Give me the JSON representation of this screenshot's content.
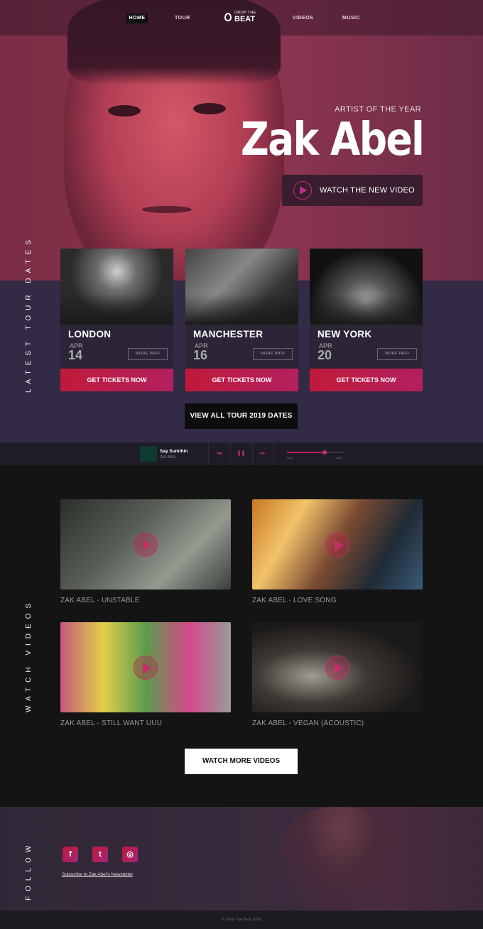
{
  "nav": {
    "home": "HOME",
    "tour": "TOUR",
    "logo_small": "DROP THE",
    "logo_big": "BEAT",
    "videos": "VIDEOS",
    "music": "MUSIC"
  },
  "hero": {
    "subtitle": "ARTIST OF THE YEAR",
    "artist_name": "Zak Abel",
    "watch_button": "WATCH THE NEW VIDEO"
  },
  "tour": {
    "section_label": "LATEST TOUR DATES",
    "cards": [
      {
        "city": "LONDON",
        "month": "APR",
        "day": "14",
        "more_info": "MORE INFO",
        "tickets": "GET TICKETS NOW"
      },
      {
        "city": "MANCHESTER",
        "month": "APR",
        "day": "16",
        "more_info": "MORE INFO",
        "tickets": "GET TICKETS NOW"
      },
      {
        "city": "NEW YORK",
        "month": "APR",
        "day": "20",
        "more_info": "MORE INFO",
        "tickets": "GET TICKETS NOW"
      }
    ],
    "view_all": "VIEW ALL TOUR 2019 DATES"
  },
  "player": {
    "title": "Say Sumthin",
    "artist": "ZAK ABEL",
    "prev_icon": "◂◂",
    "pause_icon": "❚❚",
    "next_icon": "▸▸",
    "progress": 0.66,
    "time_start": "0:00",
    "time_end": "3:04"
  },
  "videos": {
    "section_label": "WATCH VIDEOS",
    "items": [
      {
        "caption": "ZAK ABEL - UNSTABLE"
      },
      {
        "caption": "ZAK ABEL - LOVE SONG"
      },
      {
        "caption": "ZAK ABEL - STILL WANT UUU"
      },
      {
        "caption": "ZAK ABEL - VEGAN (ACOUSTIC)"
      }
    ],
    "watch_more": "WATCH MORE VIDEOS"
  },
  "follow": {
    "section_label": "FOLLOW",
    "facebook_icon": "f",
    "twitter_icon": "t",
    "instagram_icon": "◎",
    "newsletter": "Subscribe to Zak Abel's Newsletter"
  },
  "footer": {
    "copyright": "© Drop The Beat 2018"
  },
  "colors": {
    "accent": "#c2306a",
    "ticket_gradient_start": "#c01a3a",
    "ticket_gradient_end": "#b3205e",
    "tour_bg": "#332a45"
  }
}
